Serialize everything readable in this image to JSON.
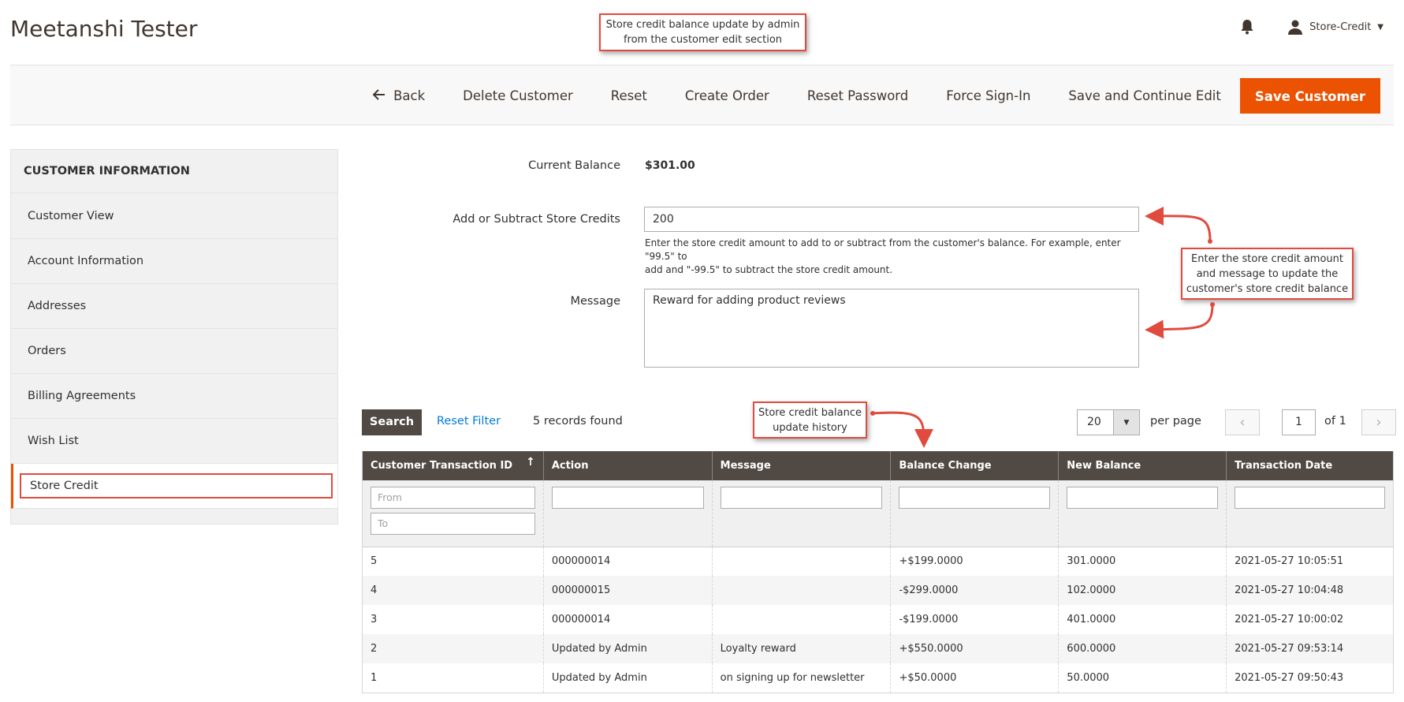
{
  "header": {
    "title": "Meetanshi Tester",
    "user_name": "Store-Credit",
    "icons": [
      "bell-icon",
      "user-icon",
      "caret-down-icon"
    ]
  },
  "callouts": {
    "top_line1": "Store credit balance update by admin",
    "top_line2": "from the customer edit section",
    "right_line1": "Enter the store credit amount",
    "right_line2": "and message to update the",
    "right_line3": "customer's store credit balance",
    "history_line1": "Store credit balance",
    "history_line2": "update history"
  },
  "actions": {
    "back": "Back",
    "delete": "Delete Customer",
    "reset": "Reset",
    "create_order": "Create Order",
    "reset_password": "Reset Password",
    "force_signin": "Force Sign-In",
    "save_continue": "Save and Continue Edit",
    "save": "Save Customer"
  },
  "sidebar": {
    "title": "CUSTOMER INFORMATION",
    "items": [
      {
        "label": "Customer View"
      },
      {
        "label": "Account Information"
      },
      {
        "label": "Addresses"
      },
      {
        "label": "Orders"
      },
      {
        "label": "Billing Agreements"
      },
      {
        "label": "Wish List"
      },
      {
        "label": "Store Credit"
      }
    ]
  },
  "form": {
    "balance_label": "Current Balance",
    "balance_value": "$301.00",
    "amount_label": "Add or Subtract Store Credits",
    "amount_value": "200",
    "amount_help_1": "Enter the store credit amount to add to or subtract from the customer's balance. For example, enter \"99.5\" to",
    "amount_help_2": "add and \"-99.5\" to subtract the store credit amount.",
    "message_label": "Message",
    "message_value": "Reward for adding product reviews"
  },
  "grid_controls": {
    "search": "Search",
    "reset_filter": "Reset Filter",
    "records": "5 records found",
    "per_page_value": "20",
    "per_page_label": "per page",
    "page": "1",
    "of": "of 1"
  },
  "table": {
    "columns": [
      "Customer Transaction ID",
      "Action",
      "Message",
      "Balance Change",
      "New Balance",
      "Transaction Date"
    ],
    "filter_from": "From",
    "filter_to": "To",
    "rows": [
      {
        "id": "5",
        "action": "000000014",
        "message": "",
        "change": "+$199.0000",
        "change_type": "pos",
        "balance": "301.0000",
        "date": "2021-05-27 10:05:51"
      },
      {
        "id": "4",
        "action": "000000015",
        "message": "",
        "change": "-$299.0000",
        "change_type": "neg",
        "balance": "102.0000",
        "date": "2021-05-27 10:04:48"
      },
      {
        "id": "3",
        "action": "000000014",
        "message": "",
        "change": "-$199.0000",
        "change_type": "neg",
        "balance": "401.0000",
        "date": "2021-05-27 10:00:02"
      },
      {
        "id": "2",
        "action": "Updated by Admin",
        "message": "Loyalty reward",
        "change": "+$550.0000",
        "change_type": "pos",
        "balance": "600.0000",
        "date": "2021-05-27 09:53:14"
      },
      {
        "id": "1",
        "action": "Updated by Admin",
        "message": "on signing up for newsletter",
        "change": "+$50.0000",
        "change_type": "pos",
        "balance": "50.0000",
        "date": "2021-05-27 09:50:43"
      }
    ]
  },
  "colors": {
    "accent": "#eb5202",
    "callout_border": "#e04b3e",
    "header_bg": "#514943",
    "positive": "#1f8a1f",
    "negative": "#e22626",
    "link": "#007bdb"
  }
}
